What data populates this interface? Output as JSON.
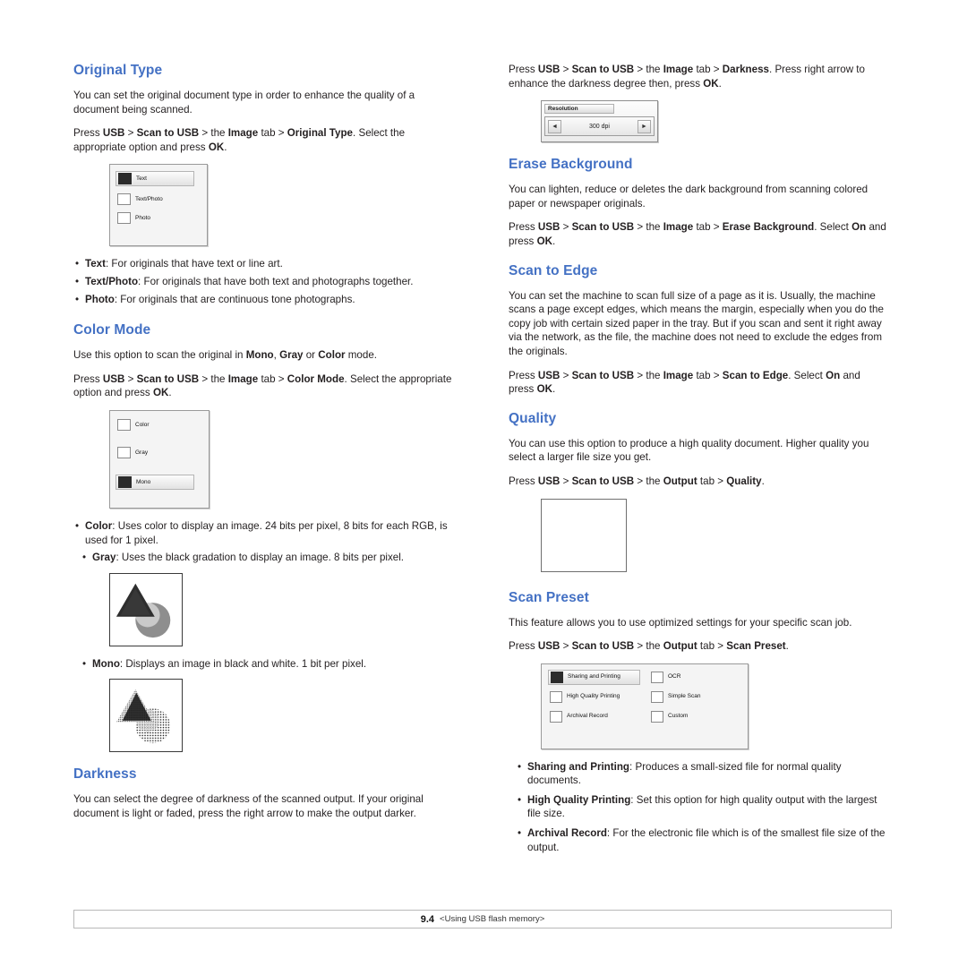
{
  "left_column": {
    "sections": [
      {
        "heading": "Original Type",
        "paras": [
          "You can set the original document type in order to enhance the quality of a document being scanned.",
          "Press USB > Scan to USB > the Image tab > Original Type. Select the appropriate option and press OK."
        ],
        "figure": {
          "name": "original-type-panel",
          "options": [
            {
              "label": "Text",
              "selected": true
            },
            {
              "label": "Text/Photo",
              "selected": false
            },
            {
              "label": "Photo",
              "selected": false
            }
          ]
        },
        "bullets": [
          "Text: For originals that have text or line art.",
          "Text/Photo: For originals that have both text and photographs together.",
          "Photo: For originals that are continuous tone photographs."
        ]
      },
      {
        "heading": "Color Mode",
        "paras": [
          "Use this option to scan the original in Mono, Gray or Color mode.",
          "Press USB > Scan to USB > the Image tab > Color Mode. Select the appropriate option and press OK."
        ],
        "figure": {
          "name": "color-mode-panel",
          "options": [
            {
              "label": "Color",
              "selected": false
            },
            {
              "label": "Gray",
              "selected": false
            },
            {
              "label": "Mono",
              "selected": true
            }
          ]
        },
        "bullets": [
          "Color: Uses color to display an image. 24 bits per pixel, 8 bits for each RGB, is used for 1 pixel.",
          "Gray: Uses the black gradation to display an image. 8 bits per pixel.",
          "Mono: Displays an image in black and white. 1 bit per pixel."
        ]
      },
      {
        "heading": "Darkness",
        "paras": [
          "You can select the degree of darkness of the scanned output. If your original document is light or faded, press the right arrow to make the output darker."
        ]
      }
    ]
  },
  "right_column": {
    "top_para": "Press USB > Scan to USB > the Image tab > Darkness. Press right arrow to enhance the darkness degree then, press OK.",
    "resolution_widget": {
      "title": "Resolution",
      "value": "300 dpi",
      "left_arrow": "◄",
      "right_arrow": "►"
    },
    "sections": [
      {
        "heading": "Erase Background",
        "paras": [
          "You can lighten, reduce or deletes the dark background from scanning colored paper or newspaper originals.",
          "Press USB > Scan to USB > the Image tab > Erase Background. Select On and press OK."
        ]
      },
      {
        "heading": "Scan to Edge",
        "paras": [
          "You can set the machine to scan full size of a page as it is. Usually, the machine scans a page except edges, which means the margin, especially when you do the copy job with certain sized paper in the tray. But if you scan and sent it right away via the network, as the file, the machine does not need to exclude the edges from the originals.",
          "Press USB > Scan to USB > the Image tab > Scan to Edge. Select On and press OK."
        ]
      },
      {
        "heading": "Quality",
        "paras": [
          "You can use this option to produce a high quality document. Higher quality you select a larger file size you get.",
          "Press USB > Scan to USB > the Output tab > Quality."
        ]
      },
      {
        "heading": "Scan Preset",
        "paras": [
          "This feature allows you to use optimized settings for your specific scan job.",
          "Press USB > Scan to USB > the Output tab > Scan Preset."
        ],
        "figure": {
          "name": "scan-preset-panel",
          "options": [
            {
              "label": "Sharing and Printing",
              "selected": true
            },
            {
              "label": "OCR",
              "selected": false
            },
            {
              "label": "High Quality Printing",
              "selected": false
            },
            {
              "label": "Simple Scan",
              "selected": false
            },
            {
              "label": "Archival Record",
              "selected": false
            },
            {
              "label": "Custom",
              "selected": false
            }
          ]
        },
        "bullets": [
          "Sharing and Printing: Produces a small-sized file for normal quality documents.",
          "High Quality Printing: Set this option for high quality output with the largest file size.",
          "Archival Record: For the electronic file which is of the smallest file size of the output."
        ]
      }
    ]
  },
  "footer": {
    "page_number": "9.4",
    "chapter": "<Using USB flash memory>"
  },
  "colors": {
    "heading": "#4471c4",
    "body": "#231f20",
    "panel_bg": "#f4f4f4",
    "panel_border": "#9a9a9a"
  }
}
